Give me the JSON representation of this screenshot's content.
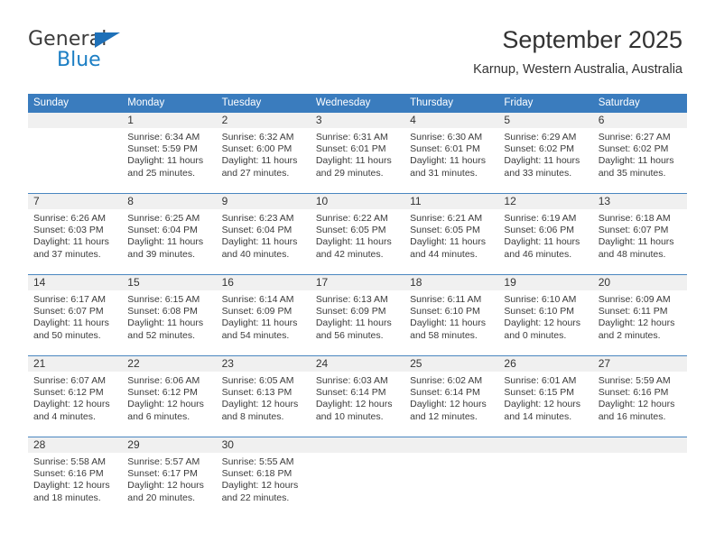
{
  "brand": {
    "name_part1": "General",
    "name_part2": "Blue",
    "accent_color": "#1b7ec4",
    "triangle_color": "#1e70b8"
  },
  "header": {
    "title": "September 2025",
    "subtitle": "Karnup, Western Australia, Australia",
    "header_bg": "#3a7cbe",
    "row_divider": "#4a86c0",
    "daynum_bg": "#f0f0f0"
  },
  "weekdays": [
    "Sunday",
    "Monday",
    "Tuesday",
    "Wednesday",
    "Thursday",
    "Friday",
    "Saturday"
  ],
  "weeks": [
    [
      {
        "day": "",
        "sunrise": "",
        "sunset": "",
        "daylight1": "",
        "daylight2": ""
      },
      {
        "day": "1",
        "sunrise": "Sunrise: 6:34 AM",
        "sunset": "Sunset: 5:59 PM",
        "daylight1": "Daylight: 11 hours",
        "daylight2": "and 25 minutes."
      },
      {
        "day": "2",
        "sunrise": "Sunrise: 6:32 AM",
        "sunset": "Sunset: 6:00 PM",
        "daylight1": "Daylight: 11 hours",
        "daylight2": "and 27 minutes."
      },
      {
        "day": "3",
        "sunrise": "Sunrise: 6:31 AM",
        "sunset": "Sunset: 6:01 PM",
        "daylight1": "Daylight: 11 hours",
        "daylight2": "and 29 minutes."
      },
      {
        "day": "4",
        "sunrise": "Sunrise: 6:30 AM",
        "sunset": "Sunset: 6:01 PM",
        "daylight1": "Daylight: 11 hours",
        "daylight2": "and 31 minutes."
      },
      {
        "day": "5",
        "sunrise": "Sunrise: 6:29 AM",
        "sunset": "Sunset: 6:02 PM",
        "daylight1": "Daylight: 11 hours",
        "daylight2": "and 33 minutes."
      },
      {
        "day": "6",
        "sunrise": "Sunrise: 6:27 AM",
        "sunset": "Sunset: 6:02 PM",
        "daylight1": "Daylight: 11 hours",
        "daylight2": "and 35 minutes."
      }
    ],
    [
      {
        "day": "7",
        "sunrise": "Sunrise: 6:26 AM",
        "sunset": "Sunset: 6:03 PM",
        "daylight1": "Daylight: 11 hours",
        "daylight2": "and 37 minutes."
      },
      {
        "day": "8",
        "sunrise": "Sunrise: 6:25 AM",
        "sunset": "Sunset: 6:04 PM",
        "daylight1": "Daylight: 11 hours",
        "daylight2": "and 39 minutes."
      },
      {
        "day": "9",
        "sunrise": "Sunrise: 6:23 AM",
        "sunset": "Sunset: 6:04 PM",
        "daylight1": "Daylight: 11 hours",
        "daylight2": "and 40 minutes."
      },
      {
        "day": "10",
        "sunrise": "Sunrise: 6:22 AM",
        "sunset": "Sunset: 6:05 PM",
        "daylight1": "Daylight: 11 hours",
        "daylight2": "and 42 minutes."
      },
      {
        "day": "11",
        "sunrise": "Sunrise: 6:21 AM",
        "sunset": "Sunset: 6:05 PM",
        "daylight1": "Daylight: 11 hours",
        "daylight2": "and 44 minutes."
      },
      {
        "day": "12",
        "sunrise": "Sunrise: 6:19 AM",
        "sunset": "Sunset: 6:06 PM",
        "daylight1": "Daylight: 11 hours",
        "daylight2": "and 46 minutes."
      },
      {
        "day": "13",
        "sunrise": "Sunrise: 6:18 AM",
        "sunset": "Sunset: 6:07 PM",
        "daylight1": "Daylight: 11 hours",
        "daylight2": "and 48 minutes."
      }
    ],
    [
      {
        "day": "14",
        "sunrise": "Sunrise: 6:17 AM",
        "sunset": "Sunset: 6:07 PM",
        "daylight1": "Daylight: 11 hours",
        "daylight2": "and 50 minutes."
      },
      {
        "day": "15",
        "sunrise": "Sunrise: 6:15 AM",
        "sunset": "Sunset: 6:08 PM",
        "daylight1": "Daylight: 11 hours",
        "daylight2": "and 52 minutes."
      },
      {
        "day": "16",
        "sunrise": "Sunrise: 6:14 AM",
        "sunset": "Sunset: 6:09 PM",
        "daylight1": "Daylight: 11 hours",
        "daylight2": "and 54 minutes."
      },
      {
        "day": "17",
        "sunrise": "Sunrise: 6:13 AM",
        "sunset": "Sunset: 6:09 PM",
        "daylight1": "Daylight: 11 hours",
        "daylight2": "and 56 minutes."
      },
      {
        "day": "18",
        "sunrise": "Sunrise: 6:11 AM",
        "sunset": "Sunset: 6:10 PM",
        "daylight1": "Daylight: 11 hours",
        "daylight2": "and 58 minutes."
      },
      {
        "day": "19",
        "sunrise": "Sunrise: 6:10 AM",
        "sunset": "Sunset: 6:10 PM",
        "daylight1": "Daylight: 12 hours",
        "daylight2": "and 0 minutes."
      },
      {
        "day": "20",
        "sunrise": "Sunrise: 6:09 AM",
        "sunset": "Sunset: 6:11 PM",
        "daylight1": "Daylight: 12 hours",
        "daylight2": "and 2 minutes."
      }
    ],
    [
      {
        "day": "21",
        "sunrise": "Sunrise: 6:07 AM",
        "sunset": "Sunset: 6:12 PM",
        "daylight1": "Daylight: 12 hours",
        "daylight2": "and 4 minutes."
      },
      {
        "day": "22",
        "sunrise": "Sunrise: 6:06 AM",
        "sunset": "Sunset: 6:12 PM",
        "daylight1": "Daylight: 12 hours",
        "daylight2": "and 6 minutes."
      },
      {
        "day": "23",
        "sunrise": "Sunrise: 6:05 AM",
        "sunset": "Sunset: 6:13 PM",
        "daylight1": "Daylight: 12 hours",
        "daylight2": "and 8 minutes."
      },
      {
        "day": "24",
        "sunrise": "Sunrise: 6:03 AM",
        "sunset": "Sunset: 6:14 PM",
        "daylight1": "Daylight: 12 hours",
        "daylight2": "and 10 minutes."
      },
      {
        "day": "25",
        "sunrise": "Sunrise: 6:02 AM",
        "sunset": "Sunset: 6:14 PM",
        "daylight1": "Daylight: 12 hours",
        "daylight2": "and 12 minutes."
      },
      {
        "day": "26",
        "sunrise": "Sunrise: 6:01 AM",
        "sunset": "Sunset: 6:15 PM",
        "daylight1": "Daylight: 12 hours",
        "daylight2": "and 14 minutes."
      },
      {
        "day": "27",
        "sunrise": "Sunrise: 5:59 AM",
        "sunset": "Sunset: 6:16 PM",
        "daylight1": "Daylight: 12 hours",
        "daylight2": "and 16 minutes."
      }
    ],
    [
      {
        "day": "28",
        "sunrise": "Sunrise: 5:58 AM",
        "sunset": "Sunset: 6:16 PM",
        "daylight1": "Daylight: 12 hours",
        "daylight2": "and 18 minutes."
      },
      {
        "day": "29",
        "sunrise": "Sunrise: 5:57 AM",
        "sunset": "Sunset: 6:17 PM",
        "daylight1": "Daylight: 12 hours",
        "daylight2": "and 20 minutes."
      },
      {
        "day": "30",
        "sunrise": "Sunrise: 5:55 AM",
        "sunset": "Sunset: 6:18 PM",
        "daylight1": "Daylight: 12 hours",
        "daylight2": "and 22 minutes."
      },
      {
        "day": "",
        "sunrise": "",
        "sunset": "",
        "daylight1": "",
        "daylight2": ""
      },
      {
        "day": "",
        "sunrise": "",
        "sunset": "",
        "daylight1": "",
        "daylight2": ""
      },
      {
        "day": "",
        "sunrise": "",
        "sunset": "",
        "daylight1": "",
        "daylight2": ""
      },
      {
        "day": "",
        "sunrise": "",
        "sunset": "",
        "daylight1": "",
        "daylight2": ""
      }
    ]
  ]
}
